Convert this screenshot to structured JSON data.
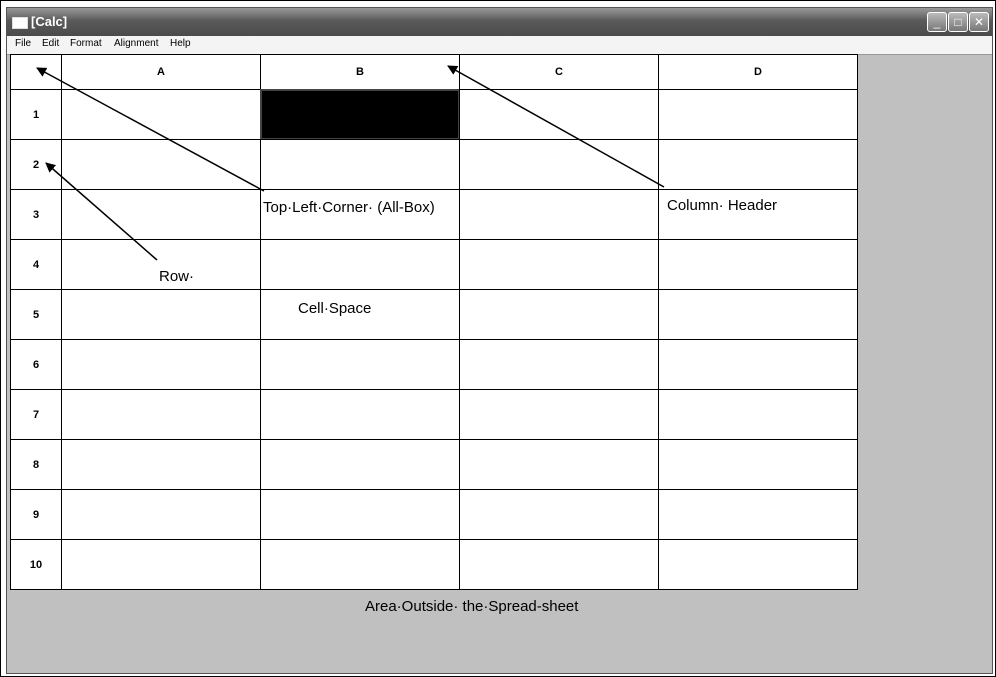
{
  "window": {
    "title": "[Calc]",
    "controls": [
      "_",
      "□",
      "✕"
    ]
  },
  "menu": [
    "File",
    "Edit",
    "Format",
    "Alignment",
    "Help"
  ],
  "columns": [
    "A",
    "B",
    "C",
    "D"
  ],
  "rows": [
    "1",
    "2",
    "3",
    "4",
    "5",
    "6",
    "7",
    "8",
    "9",
    "10"
  ],
  "selected_cell": "B1",
  "annotations": {
    "top_left": "Top·Left·Corner· (All-Box)",
    "column_header": "Column· Header",
    "row": "Row·",
    "cell_space": "Cell·Space",
    "outside": "Area·Outside· the·Spread-sheet"
  },
  "colors": {
    "selected_cell": "#000000",
    "outside_area": "#c0c0c0"
  }
}
